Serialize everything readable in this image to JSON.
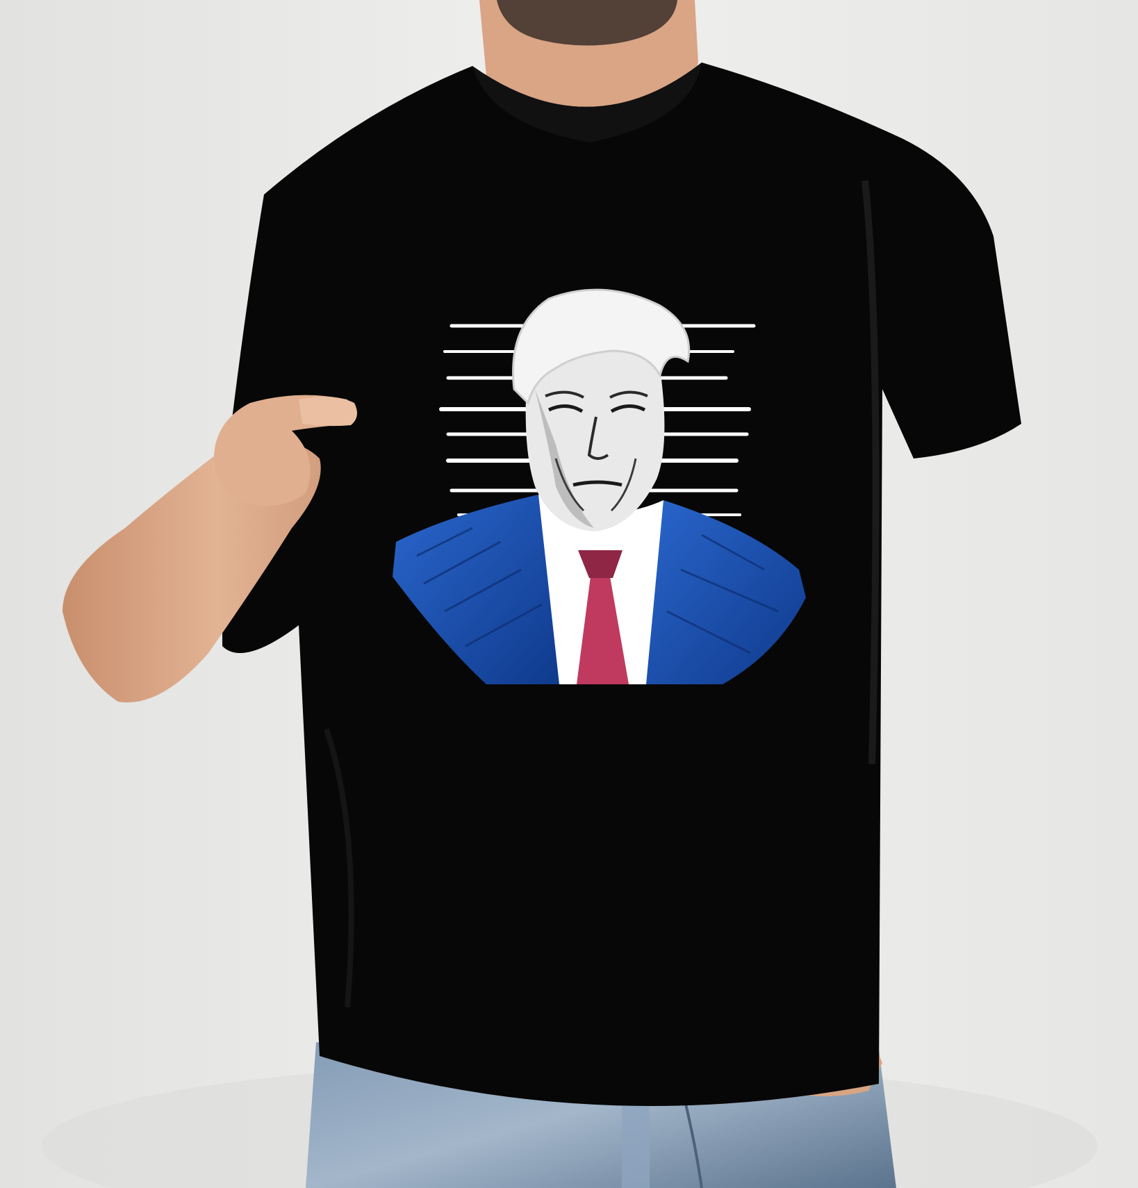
{
  "photo": {
    "subject": "man-wearing-black-graphic-tshirt",
    "colors": {
      "background_wall": "#ebebe9",
      "background_shadow": "#d4d4d2",
      "skin": "#dfae8f",
      "skin_shadow": "#c58d6c",
      "beard": "#3b2e28",
      "shirt": "#070707",
      "shirt_fold": "#161616",
      "jeans": "#6f8aa6",
      "jeans_light": "#a9bbcd",
      "jeans_dark": "#4b627a"
    }
  },
  "shirt_print": {
    "icon": "portrait-illustration",
    "colors": {
      "lineup_lines": "#ffffff",
      "hair": "#f4f4f4",
      "face": "#e9e9e9",
      "face_ink": "#1a1a1a",
      "suit": "#1f56b8",
      "suit_dark": "#0e2f73",
      "shirt_collar": "#ffffff",
      "tie": "#c03a5f",
      "tie_dark": "#8f2645"
    }
  }
}
